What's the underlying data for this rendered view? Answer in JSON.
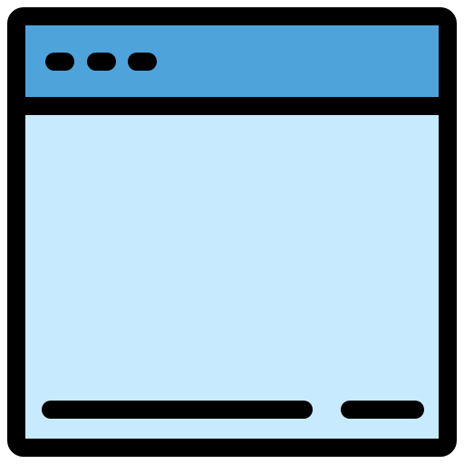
{
  "icon": {
    "name": "browser-window-icon",
    "colors": {
      "outline": "#000000",
      "title_bar": "#4FA3DB",
      "content": "#C8EAFF"
    }
  }
}
